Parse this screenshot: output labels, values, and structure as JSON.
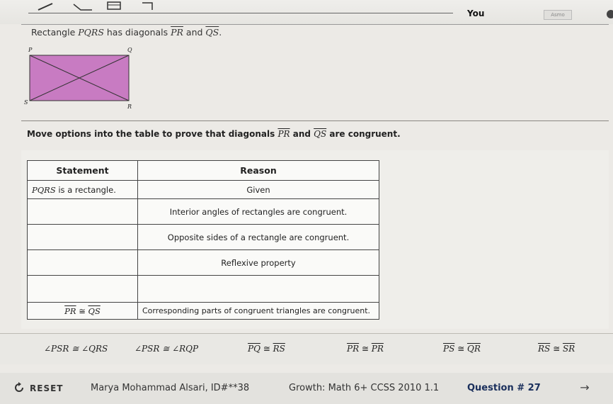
{
  "header": {
    "user_label": "You",
    "user_box_text": "Asmo"
  },
  "intro": {
    "prefix": "Rectangle ",
    "shape_name": "PQRS",
    "middle": " has diagonals ",
    "diag1": "PR",
    "and": " and ",
    "diag2": "QS",
    "end": "."
  },
  "figure": {
    "vertices": {
      "p": "P",
      "q": "Q",
      "r": "R",
      "s": "S"
    },
    "fill_color": "#c87bc2"
  },
  "prompt": {
    "prefix": "Move options into the table to prove that diagonals ",
    "seg1": "PR",
    "and": " and ",
    "seg2": "QS",
    "suffix": " are congruent."
  },
  "table": {
    "headers": {
      "statement": "Statement",
      "reason": "Reason"
    },
    "rows": [
      {
        "statement_italic": "PQRS",
        "statement_rest": " is a rectangle.",
        "reason": "Given"
      },
      {
        "statement": "",
        "reason": "Interior angles of rectangles are congruent."
      },
      {
        "statement": "",
        "reason": "Opposite sides of a rectangle are congruent."
      },
      {
        "statement": "",
        "reason": "Reflexive property"
      },
      {
        "statement": "",
        "reason": ""
      },
      {
        "statement_a": "PR",
        "statement_op": " ≅ ",
        "statement_b": "QS",
        "reason": "Corresponding parts of congruent triangles are congruent."
      }
    ]
  },
  "options": [
    {
      "text": "∠PSR ≅ ∠QRS"
    },
    {
      "text": "∠PSR ≅ ∠RQP"
    },
    {
      "a": "PQ",
      "op": " ≅ ",
      "b": "RS"
    },
    {
      "a": "PR",
      "op": " ≅ ",
      "b": "PR"
    },
    {
      "a": "PS",
      "op": " ≅ ",
      "b": "QR"
    },
    {
      "a": "RS",
      "op": " ≅ ",
      "b": "SR"
    }
  ],
  "footer": {
    "reset_label": "RESET",
    "student": "Marya Mohammad Alsari, ID#**38",
    "course": "Growth: Math 6+ CCSS 2010 1.1",
    "question": "Question # 27",
    "next_arrow": "→"
  }
}
